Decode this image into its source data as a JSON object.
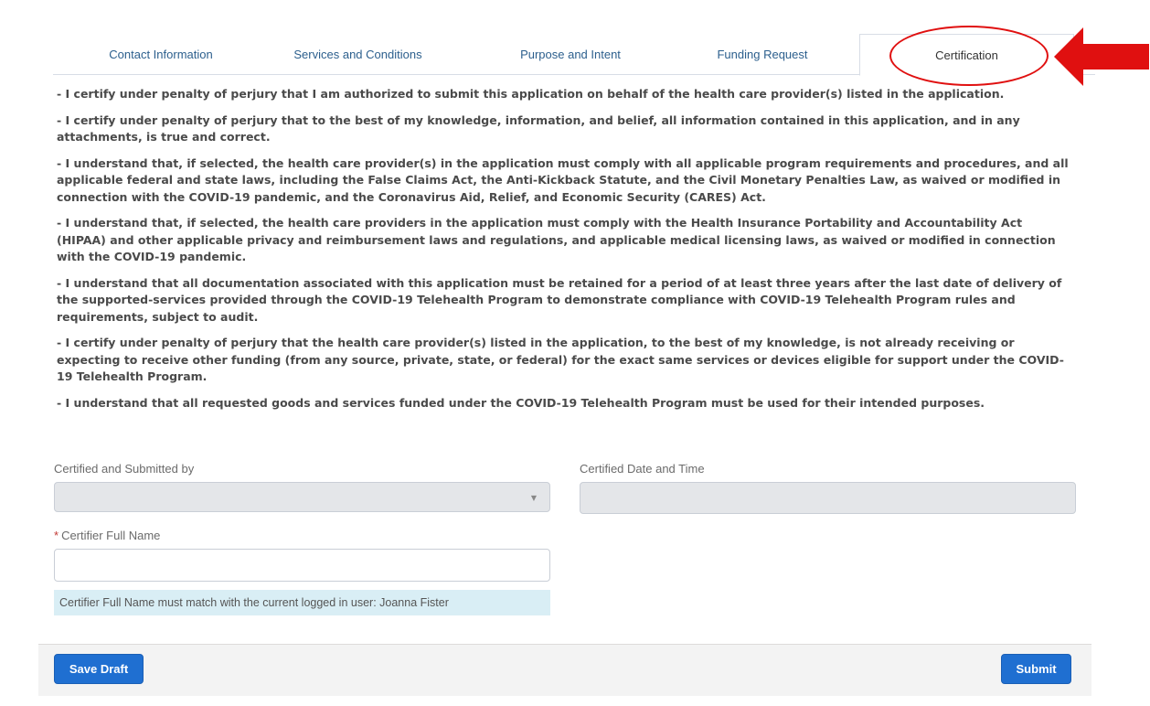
{
  "tabs": [
    {
      "label": "Contact Information",
      "active": false
    },
    {
      "label": "Services and Conditions",
      "active": false
    },
    {
      "label": "Purpose and Intent",
      "active": false
    },
    {
      "label": "Funding Request",
      "active": false
    },
    {
      "label": "Certification",
      "active": true
    }
  ],
  "certifications": [
    "- I certify under penalty of perjury that I am authorized to submit this application on behalf of the health care provider(s) listed in the application.",
    "- I certify under penalty of perjury that to the best of my knowledge, information, and belief, all information contained in this application, and in any attachments, is true and correct.",
    "- I understand that, if selected, the health care provider(s) in the application must comply with all applicable program requirements and procedures, and all applicable federal and state laws, including the False Claims Act, the Anti-Kickback Statute, and the Civil Monetary Penalties Law, as waived or modified in connection with the COVID-19 pandemic, and the Coronavirus Aid, Relief, and Economic Security (CARES) Act.",
    "- I understand that, if selected, the health care providers in the application must comply with the Health Insurance Portability and Accountability Act (HIPAA) and other applicable privacy and reimbursement laws and regulations, and applicable medical licensing laws, as waived or modified in connection with the COVID-19 pandemic.",
    "- I understand that all documentation associated with this application must be retained for a period of at least three years after the last date of delivery of the supported-services provided through the COVID-19 Telehealth Program to demonstrate compliance with COVID-19 Telehealth Program rules and requirements, subject to audit.",
    "- I certify under penalty of perjury that the health care provider(s) listed in the application, to the best of my knowledge, is not already receiving or expecting to receive other funding (from any source, private, state, or federal) for the exact same services or devices eligible for support under the COVID-19 Telehealth Program.",
    "- I understand that all requested goods and services funded under the COVID-19 Telehealth Program must be used for their intended purposes."
  ],
  "form": {
    "certified_by_label": "Certified and Submitted by",
    "certified_by_value": "",
    "certified_date_label": "Certified Date and Time",
    "certified_date_value": "",
    "certifier_name_label": "Certifier Full Name",
    "certifier_name_required_mark": "*",
    "certifier_name_value": "",
    "certifier_name_hint": "Certifier Full Name must match with the current logged in user: Joanna Fister"
  },
  "footer": {
    "save_draft_label": "Save Draft",
    "submit_label": "Submit"
  },
  "icons": {
    "dropdown": "chevron-down-icon",
    "annotation_arrow": "arrow-left-icon"
  },
  "colors": {
    "accent": "#1f6fd1",
    "annotation": "#e01010",
    "tab_text": "#2c5f8d",
    "hint_background": "#d9eef5"
  }
}
